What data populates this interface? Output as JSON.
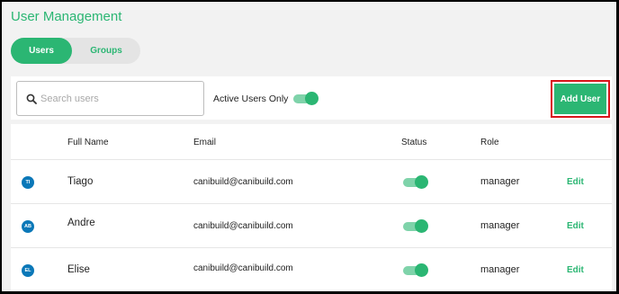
{
  "header": {
    "title": "User Management"
  },
  "tabs": [
    {
      "label": "Users",
      "active": true
    },
    {
      "label": "Groups",
      "active": false
    }
  ],
  "toolbar": {
    "search_placeholder": "Search users",
    "search_value": "",
    "active_only_label": "Active Users Only",
    "active_only_on": true,
    "add_button_label": "Add User"
  },
  "table": {
    "columns": [
      "Full Name",
      "Email",
      "Status",
      "Role"
    ],
    "rows": [
      {
        "initials": "TI",
        "name": "Tiago",
        "email": "canibuild@canibuild.com",
        "status_on": true,
        "role": "manager",
        "action": "Edit"
      },
      {
        "initials": "AB",
        "name": "Andre",
        "email": "canibuild@canibuild.com",
        "status_on": true,
        "role": "manager",
        "action": "Edit"
      },
      {
        "initials": "EL",
        "name": "Elise",
        "email": "canibuild@canibuild.com",
        "status_on": true,
        "role": "manager",
        "action": "Edit"
      }
    ]
  },
  "colors": {
    "accent": "#2bb673",
    "accent_light": "#7fd3aa",
    "avatar": "#0b78b8",
    "highlight": "#d9151b"
  }
}
